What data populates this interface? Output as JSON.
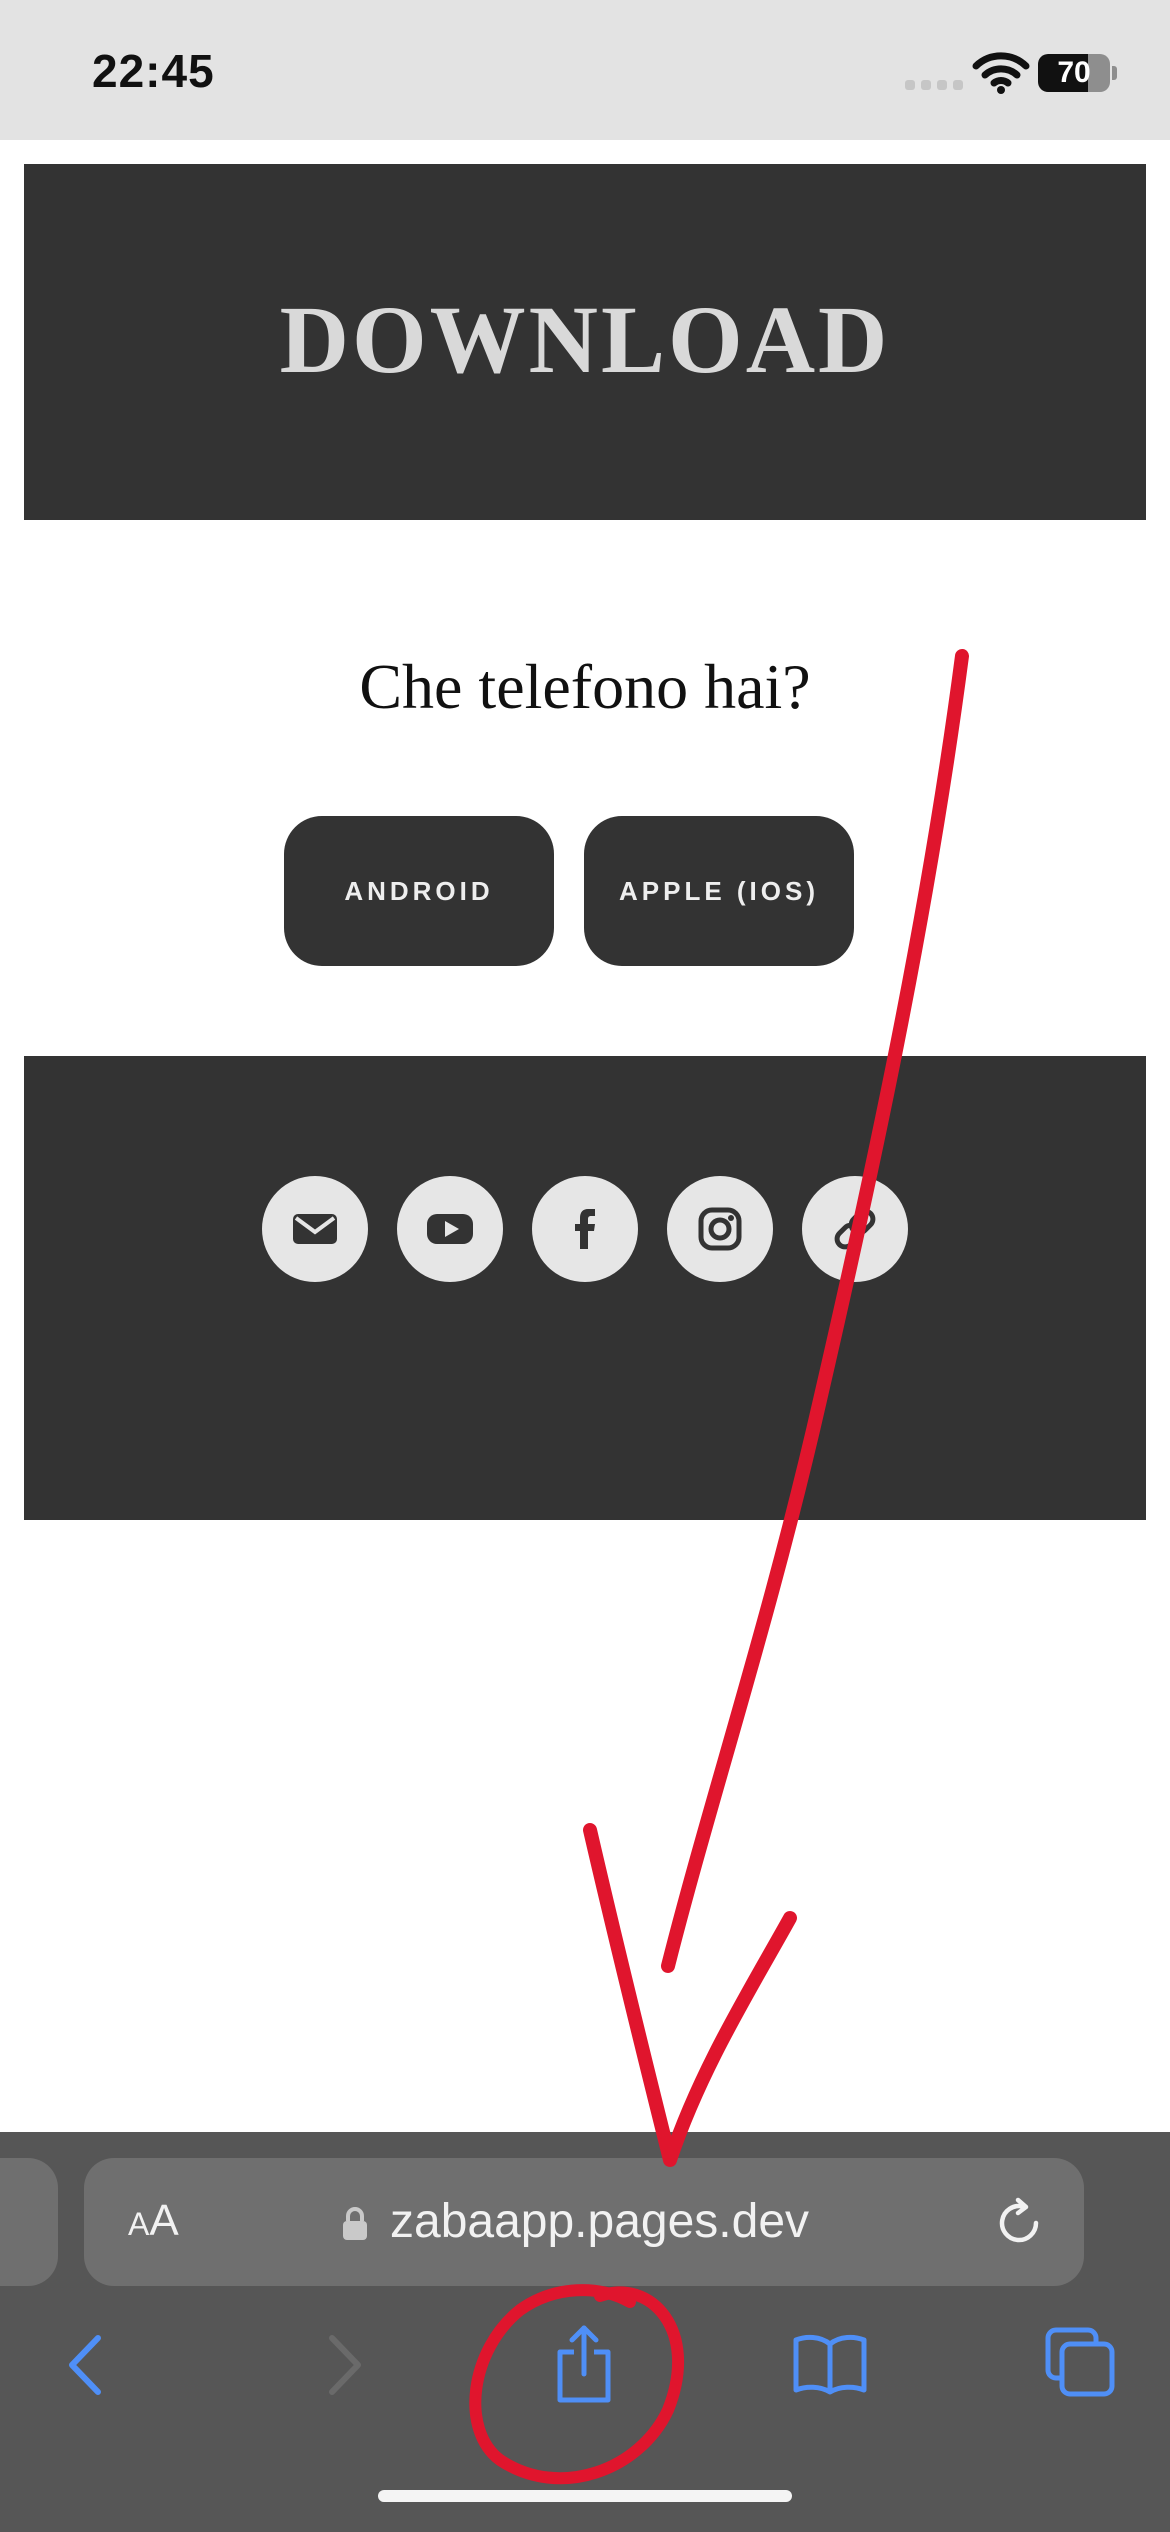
{
  "status_bar": {
    "time": "22:45",
    "battery": "70",
    "battery_level": 0.7,
    "icons": [
      "signal-icon",
      "wifi-icon",
      "battery-icon"
    ]
  },
  "page": {
    "hero_title": "DOWNLOAD",
    "question": "Che telefono hai?",
    "buttons": {
      "android": "ANDROID",
      "apple": "APPLE (IOS)"
    },
    "social_icons": [
      "mail-icon",
      "youtube-icon",
      "facebook-icon",
      "instagram-icon",
      "link-icon"
    ]
  },
  "browser": {
    "text_size_label_small": "A",
    "text_size_label_large": "A",
    "url": "zabaapp.pages.dev",
    "toolbar_icons": [
      "back-icon",
      "forward-icon",
      "share-icon",
      "bookmarks-icon",
      "tabs-icon"
    ]
  },
  "colors": {
    "dark_block": "#333333",
    "annotation_red": "#e0152d",
    "safari_blue": "#4f8ff7"
  }
}
